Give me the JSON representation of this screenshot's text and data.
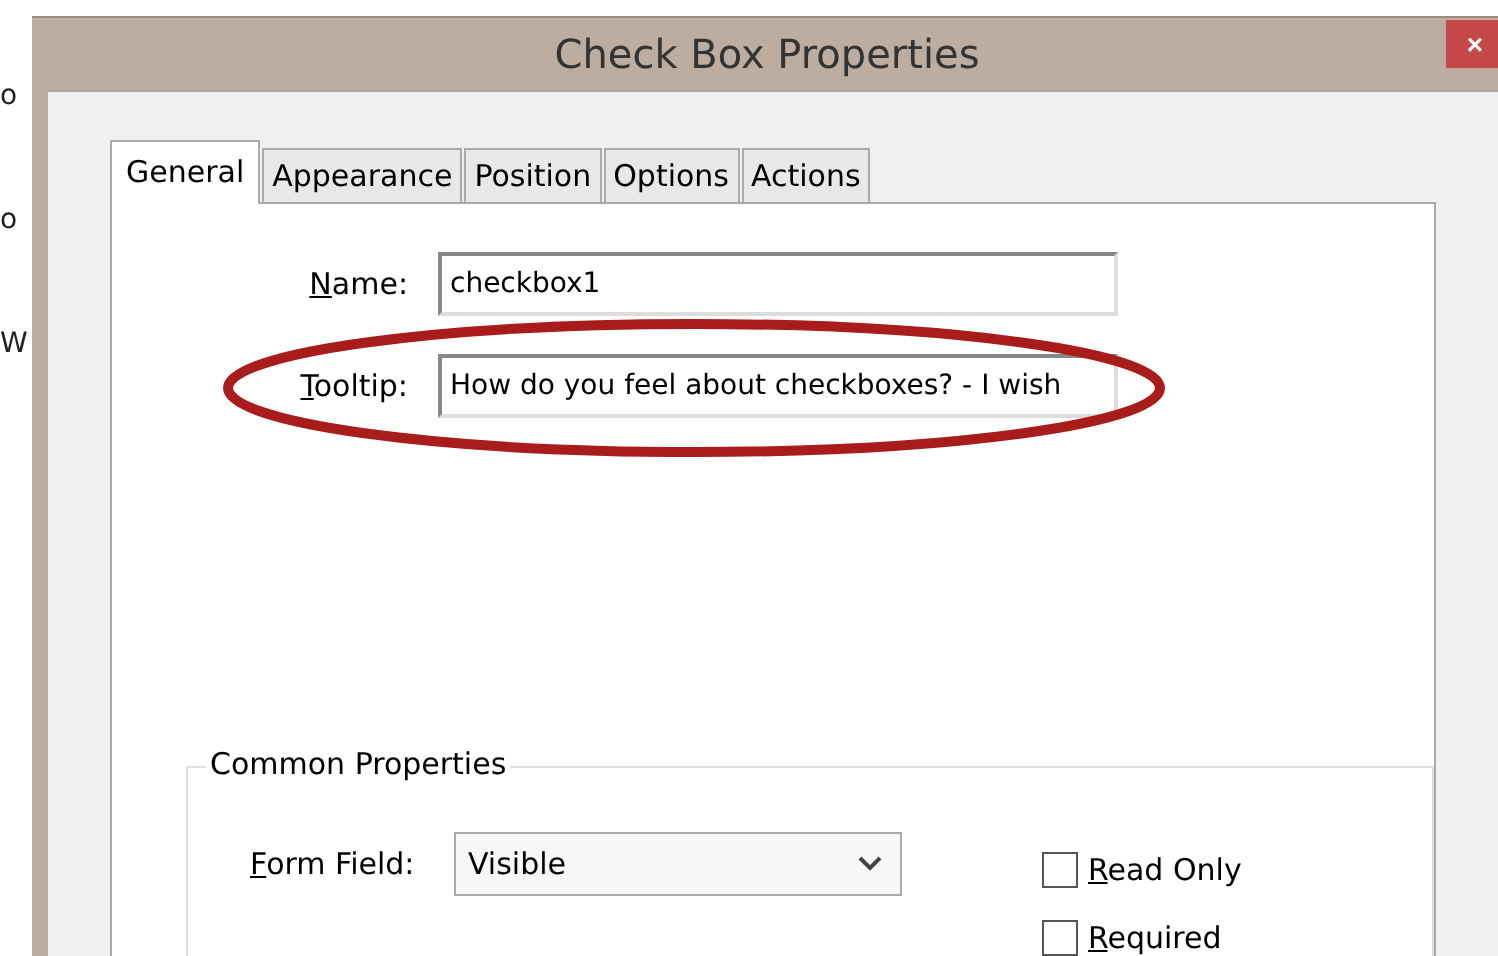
{
  "background_fragments": [
    "o",
    "o",
    "W"
  ],
  "window": {
    "title": "Check Box Properties",
    "close": "×"
  },
  "tabs": [
    {
      "label": "General",
      "selected": true
    },
    {
      "label": "Appearance",
      "selected": false
    },
    {
      "label": "Position",
      "selected": false
    },
    {
      "label": "Options",
      "selected": false
    },
    {
      "label": "Actions",
      "selected": false
    }
  ],
  "fields": [
    {
      "label": "Name:",
      "value": "checkbox1",
      "highlighted": false
    },
    {
      "label": "Tooltip:",
      "value": "How do you feel about checkboxes? - I wish",
      "highlighted": true
    }
  ],
  "common_properties": {
    "title": "Common Properties",
    "form_field": {
      "label": "Form Field:",
      "value": "Visible"
    },
    "checkboxes": [
      {
        "label": "Read Only",
        "checked": false
      },
      {
        "label": "Required",
        "checked": false
      }
    ]
  }
}
